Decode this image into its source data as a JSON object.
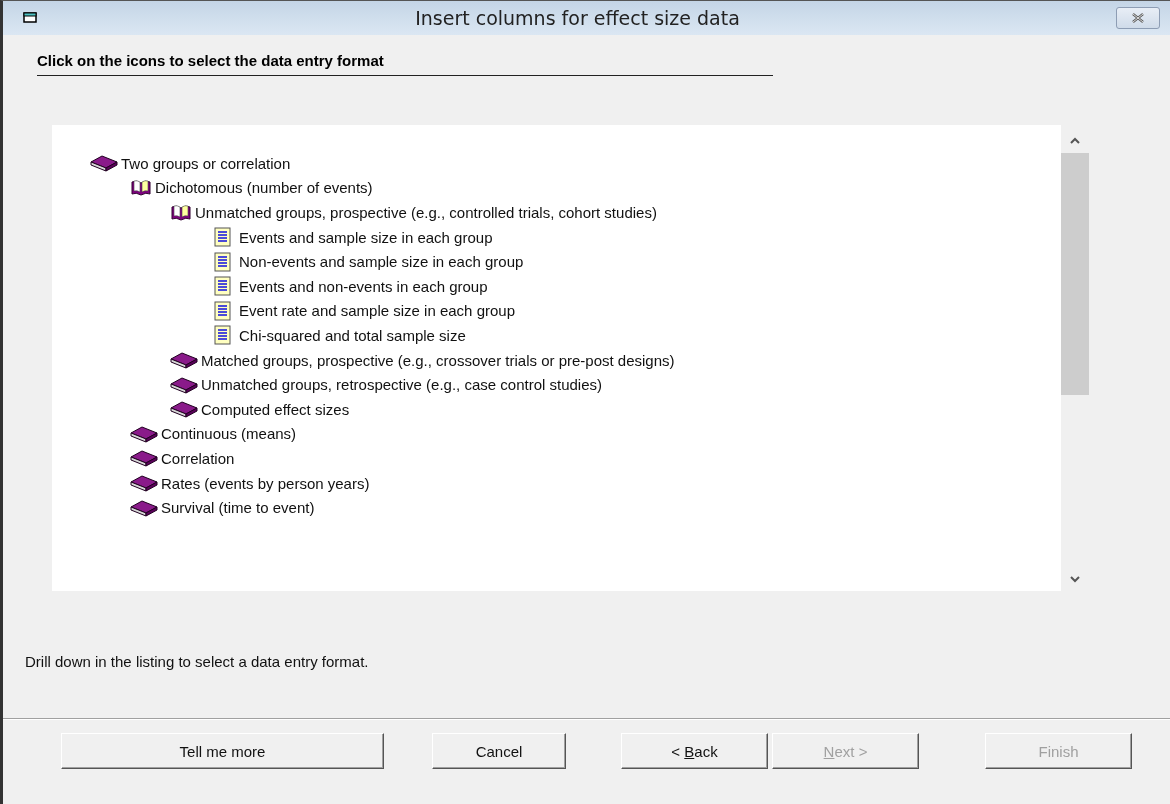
{
  "window": {
    "title": "Insert columns for effect size data"
  },
  "heading": "Click on the icons to select the data entry format",
  "tree": [
    {
      "label": "Two groups or correlation",
      "kind": "book",
      "children": [
        {
          "label": "Dichotomous (number of events)",
          "kind": "open-book",
          "children": [
            {
              "label": "Unmatched groups, prospective (e.g., controlled trials, cohort studies)",
              "kind": "open-book",
              "children": [
                {
                  "label": "Events and sample size in each group",
                  "kind": "format"
                },
                {
                  "label": "Non-events and sample size in each group",
                  "kind": "format"
                },
                {
                  "label": "Events and non-events in each group",
                  "kind": "format"
                },
                {
                  "label": "Event rate and sample size in each group",
                  "kind": "format"
                },
                {
                  "label": "Chi-squared and total sample size",
                  "kind": "format"
                }
              ]
            },
            {
              "label": "Matched groups, prospective (e.g., crossover trials or pre-post designs)",
              "kind": "book"
            },
            {
              "label": "Unmatched groups, retrospective (e.g., case control studies)",
              "kind": "book"
            },
            {
              "label": "Computed effect sizes",
              "kind": "book"
            }
          ]
        },
        {
          "label": "Continuous (means)",
          "kind": "book"
        },
        {
          "label": "Correlation",
          "kind": "book"
        },
        {
          "label": "Rates (events by person years)",
          "kind": "book"
        },
        {
          "label": "Survival (time to event)",
          "kind": "book"
        }
      ]
    }
  ],
  "status": "Drill down in the listing to select a data entry format.",
  "buttons": [
    {
      "before": "Tell me more",
      "disabled": false
    },
    {
      "before": "Cancel",
      "disabled": false
    },
    {
      "before": "< ",
      "key": "B",
      "after": "ack",
      "disabled": false
    },
    {
      "key": "N",
      "after": "ext >",
      "disabled": true
    },
    {
      "before": "Finish",
      "disabled": true
    }
  ]
}
